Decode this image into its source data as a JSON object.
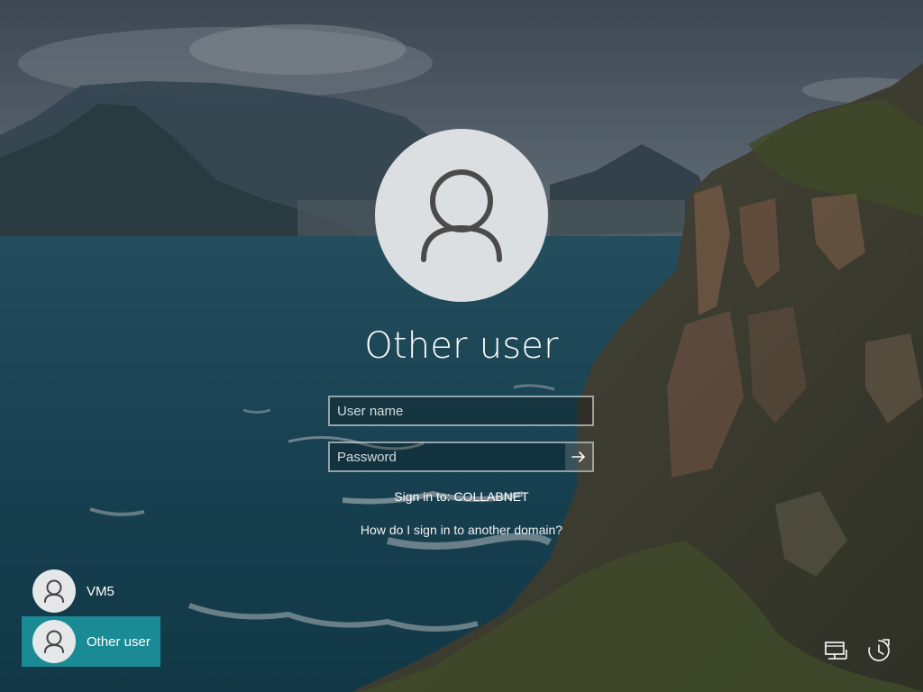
{
  "login": {
    "title": "Other user",
    "username_placeholder": "User name",
    "password_placeholder": "Password",
    "sign_in_to": "Sign in to: COLLABNET",
    "domain_help_link": "How do I sign in to another domain?"
  },
  "users": [
    {
      "name": "VM5",
      "selected": false
    },
    {
      "name": "Other user",
      "selected": true
    }
  ],
  "icons": {
    "avatar": "user-silhouette-icon",
    "submit": "arrow-right-icon",
    "network": "network-icon",
    "ease_of_access": "ease-of-access-icon"
  },
  "colors": {
    "selected_tile": "#1a8a94",
    "avatar_bg": "#dcdfe1"
  }
}
